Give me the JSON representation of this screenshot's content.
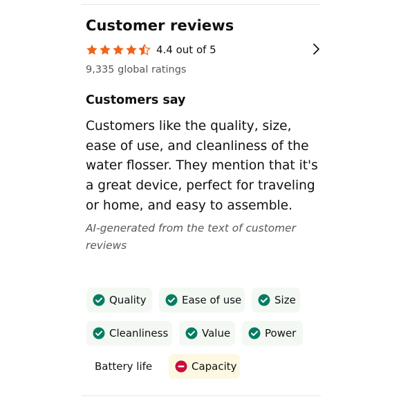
{
  "header": {
    "title": "Customer reviews"
  },
  "rating": {
    "stars": 4.4,
    "max_stars": 5,
    "text": "4.4 out of 5",
    "global_ratings": "9,335 global ratings",
    "star_color": "#f0641a"
  },
  "customers_say": {
    "heading": "Customers say",
    "summary": "Customers like the quality, size, ease of use, and cleanliness of the water flosser. They mention that it's a great device, perfect for traveling or home, and easy to assemble.",
    "ai_note": "AI-generated from the text of customer reviews"
  },
  "aspects": [
    {
      "label": "Quality",
      "sentiment": "positive",
      "icon": "check-circle-icon"
    },
    {
      "label": "Ease of use",
      "sentiment": "positive",
      "icon": "check-circle-icon"
    },
    {
      "label": "Size",
      "sentiment": "positive",
      "icon": "check-circle-icon"
    },
    {
      "label": "Cleanliness",
      "sentiment": "positive",
      "icon": "check-circle-icon"
    },
    {
      "label": "Value",
      "sentiment": "positive",
      "icon": "check-circle-icon"
    },
    {
      "label": "Power",
      "sentiment": "positive",
      "icon": "check-circle-icon"
    },
    {
      "label": "Battery life",
      "sentiment": "mixed",
      "icon": ""
    },
    {
      "label": "Capacity",
      "sentiment": "negative",
      "icon": "minus-circle-icon"
    }
  ],
  "colors": {
    "positive": "#067d62",
    "negative": "#cc0c39",
    "positive_bg": "#f3f8f3",
    "negative_bg": "#fdf8e2"
  }
}
